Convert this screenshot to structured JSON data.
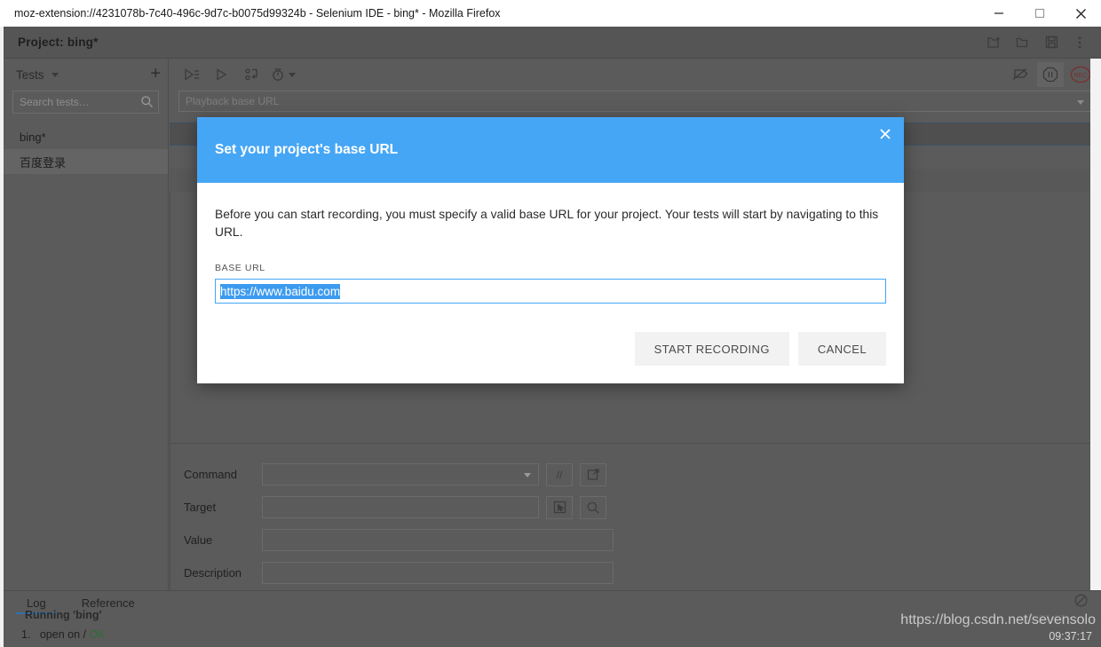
{
  "window": {
    "title": "moz-extension://4231078b-7c40-496c-9d7c-b0075d99324b - Selenium IDE - bing* - Mozilla Firefox",
    "controls": {
      "minimize": "minimize-icon",
      "maximize": "maximize-icon",
      "close": "close-icon"
    }
  },
  "project": {
    "title": "Project:  bing*",
    "actions": [
      "new-project-icon",
      "open-project-icon",
      "save-project-icon",
      "more-menu-icon"
    ]
  },
  "sidebar": {
    "heading": "Tests",
    "add_label": "+",
    "search": {
      "placeholder": "Search tests…",
      "value": ""
    },
    "items": [
      {
        "label": "bing*",
        "selected": false
      },
      {
        "label": "百度登录",
        "selected": true
      }
    ]
  },
  "toolbar": {
    "left_icons": [
      "run-all-tests-icon",
      "run-current-test-icon",
      "step-over-icon",
      "playback-speed-icon"
    ],
    "right_icons": [
      "disable-breakpoints-icon",
      "pause-icon",
      "record-icon"
    ],
    "record_label": "REC"
  },
  "playback": {
    "placeholder": "Playback base URL",
    "value": ""
  },
  "command_form": {
    "rows": [
      {
        "label": "Command",
        "value": "",
        "type": "select"
      },
      {
        "label": "Target",
        "value": "",
        "type": "text"
      },
      {
        "label": "Value",
        "value": "",
        "type": "text"
      },
      {
        "label": "Description",
        "value": "",
        "type": "text"
      }
    ],
    "command_buttons": [
      "comment-toggle-icon",
      "open-command-reference-icon"
    ],
    "comment_label": "//",
    "target_buttons": [
      "select-target-icon",
      "find-target-icon"
    ]
  },
  "log": {
    "tabs": [
      {
        "label": "Log",
        "active": true
      },
      {
        "label": "Reference",
        "active": false
      }
    ],
    "clear_icon": "clear-log-icon",
    "running_text": "Running 'bing'",
    "entries": [
      {
        "index": "1.",
        "text": "open on /",
        "status": "OK"
      }
    ],
    "watermark": "https://blog.csdn.net/sevensolo",
    "clock": "09:37:17"
  },
  "dialog": {
    "title": "Set your project's base URL",
    "close_icon": "close-icon",
    "body_text": "Before you can start recording, you must specify a valid base URL for your project. Your tests will start by navigating to this URL.",
    "field_label": "BASE URL",
    "field_value": "https://www.baidu.com",
    "primary_button": "START RECORDING",
    "secondary_button": "CANCEL"
  },
  "colors": {
    "accent_blue": "#45a6f5",
    "selection_blue": "#3d9bef",
    "app_bg": "#5b5b5b",
    "record_red": "#7a2f2f",
    "ok_green": "#2f6b33"
  }
}
